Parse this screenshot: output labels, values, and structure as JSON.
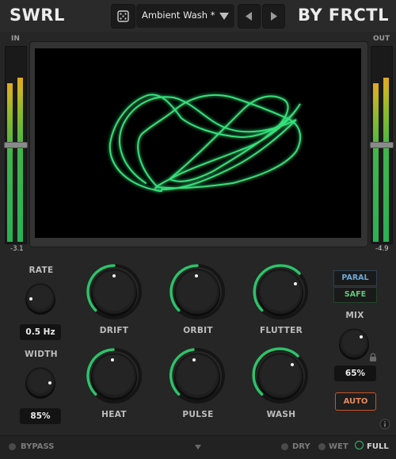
{
  "header": {
    "brand_left": "SWRL",
    "brand_right": "BY FRCTL",
    "preset_name": "Ambient Wash *",
    "icons": [
      "dice-icon",
      "caret-down-icon",
      "prev-arrow-icon",
      "next-arrow-icon"
    ]
  },
  "meters": {
    "in_label": "IN",
    "out_label": "OUT",
    "in_value": "-3.1",
    "out_value": "-4.9",
    "in_levels": [
      0.82,
      0.85
    ],
    "out_levels": [
      0.82,
      0.85
    ]
  },
  "knobs": {
    "rate": {
      "label": "RATE",
      "value": "0.5 Hz"
    },
    "width": {
      "label": "WIDTH",
      "value": "85%"
    },
    "drift": {
      "label": "DRIFT"
    },
    "orbit": {
      "label": "ORBIT"
    },
    "flutter": {
      "label": "FLUTTER"
    },
    "heat": {
      "label": "HEAT"
    },
    "pulse": {
      "label": "PULSE"
    },
    "wash": {
      "label": "WASH"
    },
    "mix": {
      "label": "MIX",
      "value": "65%"
    }
  },
  "buttons": {
    "paral": "PARAL",
    "safe": "SAFE",
    "auto": "AUTO"
  },
  "footer": {
    "bypass": "BYPASS",
    "dry": "DRY",
    "wet": "WET",
    "full": "FULL"
  },
  "colors": {
    "accent_green": "#2ec26a",
    "trace_green": "#35e07a",
    "auto_orange": "#c8552a",
    "paral_blue": "#6fa8d8"
  }
}
